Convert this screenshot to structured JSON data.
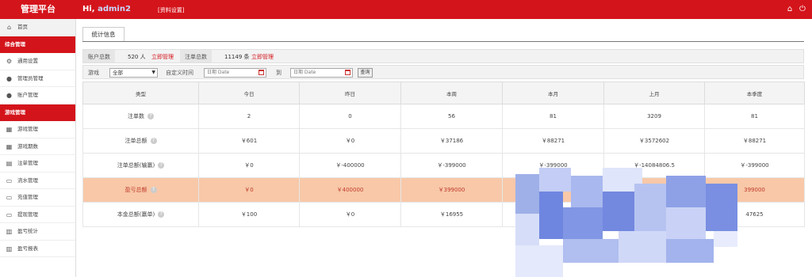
{
  "header": {
    "brand": "管理平台",
    "greeting_prefix": "Hi, ",
    "username": "admin2",
    "profile_link": "[资料设置]",
    "home_icon": "home-icon",
    "power_icon": "power-icon"
  },
  "sidebar": {
    "home": "首页",
    "section1": "综合管理",
    "section1_items": [
      "通用设置",
      "管理员管理",
      "账户管理"
    ],
    "section2": "游戏管理",
    "section2_items": [
      "游戏管理",
      "游戏期数",
      "注单管理",
      "流水管理",
      "充值管理",
      "提现管理",
      "盈亏统计",
      "盈亏报表"
    ]
  },
  "tab": {
    "label": "统计信息"
  },
  "stats": {
    "accounts_label": "账户总数",
    "accounts_value": "520 人",
    "accounts_link": "立即管理",
    "orders_label": "注单总数",
    "orders_value": "11149 条",
    "orders_link": "立即管理"
  },
  "filter": {
    "game_label": "游戏",
    "game_selected": "全部",
    "custom_label": "自定义时间",
    "date_from_placeholder": "日期 Date",
    "to_label": "到",
    "date_to_placeholder": "日期 Date",
    "query_button": "查询"
  },
  "table": {
    "headers": [
      "类型",
      "今日",
      "昨日",
      "本周",
      "本月",
      "上月",
      "本季度"
    ],
    "rows": [
      {
        "label": "注单数",
        "values": [
          "2",
          "0",
          "56",
          "81",
          "3209",
          "81"
        ]
      },
      {
        "label": "注单总额",
        "values": [
          "￥601",
          "￥0",
          "￥37186",
          "￥88271",
          "￥3572602",
          "￥88271"
        ]
      },
      {
        "label": "注单总额(输赢)",
        "values": [
          "￥0",
          "￥-400000",
          "￥-399000",
          "￥-399000",
          "￥-14084806.5",
          "￥-399000"
        ]
      },
      {
        "label": "盈亏总额",
        "values": [
          "￥0",
          "￥400000",
          "￥399000",
          "",
          "",
          "399000"
        ]
      },
      {
        "label": "本金总额(赢单)",
        "values": [
          "￥100",
          "￥0",
          "￥16955",
          "",
          "",
          "47625"
        ]
      }
    ]
  }
}
